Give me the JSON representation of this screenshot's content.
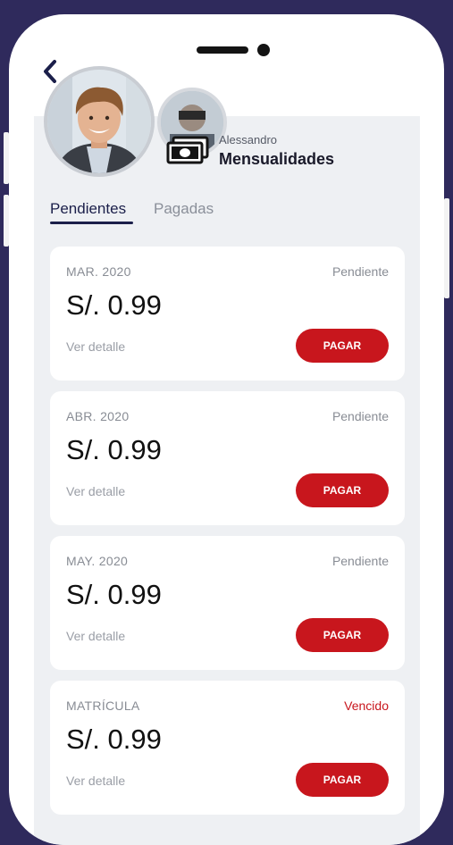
{
  "header": {
    "child_name": "Alessandro",
    "title": "Mensualidades"
  },
  "icons": {
    "back": "chevron-left-icon",
    "money": "banknote-icon"
  },
  "tabs": [
    {
      "label": "Pendientes",
      "active": true
    },
    {
      "label": "Pagadas",
      "active": false
    }
  ],
  "colors": {
    "background": "#2f2a5c",
    "accent": "#1b1f4a",
    "pay_button": "#c8161d",
    "overdue": "#c8161d"
  },
  "cards": [
    {
      "period": "MAR. 2020",
      "status": "Pendiente",
      "amount": "S/. 0.99",
      "detail_link": "Ver detalle",
      "pay_label": "PAGAR"
    },
    {
      "period": "ABR. 2020",
      "status": "Pendiente",
      "amount": "S/. 0.99",
      "detail_link": "Ver detalle",
      "pay_label": "PAGAR"
    },
    {
      "period": "MAY. 2020",
      "status": "Pendiente",
      "amount": "S/. 0.99",
      "detail_link": "Ver detalle",
      "pay_label": "PAGAR"
    },
    {
      "period": "MATRÍCULA",
      "status": "Vencido",
      "amount": "S/. 0.99",
      "detail_link": "Ver detalle",
      "pay_label": "PAGAR"
    }
  ]
}
